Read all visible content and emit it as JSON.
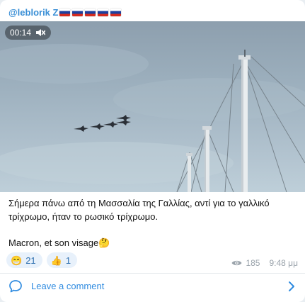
{
  "channel": {
    "name": "@leblorik Z",
    "flag_count": 5,
    "flag_colors": [
      "#ffffff",
      "#1c3f9e",
      "#d52b1e"
    ]
  },
  "media": {
    "duration": "00:14",
    "muted_icon": "speaker-muted-icon",
    "description_icon": "video"
  },
  "caption": {
    "line1": "Σήμερα πάνω από τη Μασσαλία της Γαλλίας, αντί για το γαλλικό τρίχρωμο, ήταν το ρωσικό τρίχρωμο.",
    "line2_text": "Macron, et son visage",
    "line2_emoji": "🤔"
  },
  "reactions": [
    {
      "emoji": "😁",
      "count": "21"
    },
    {
      "emoji": "👍",
      "count": "1"
    }
  ],
  "meta": {
    "views": "185",
    "time": "9:48 μμ"
  },
  "comments": {
    "label": "Leave a comment"
  },
  "colors": {
    "accent": "#2f8be0",
    "channel_name": "#3a8fd6"
  }
}
